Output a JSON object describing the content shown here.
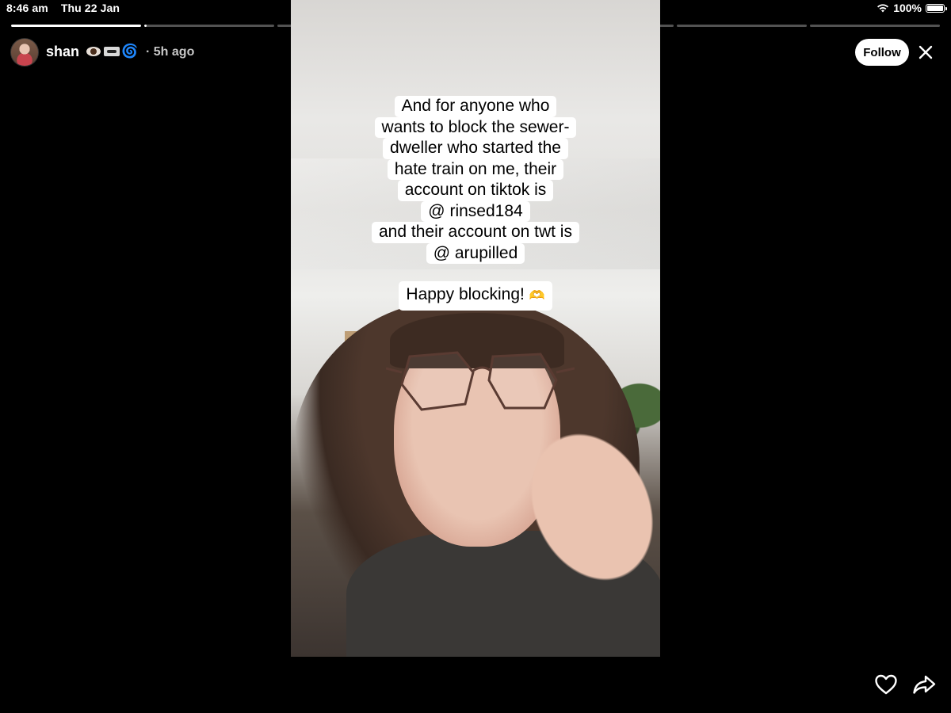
{
  "status_bar": {
    "time": "8:46 am",
    "date": "Thu 22 Jan",
    "battery": "100%",
    "wifi_icon": "wifi-icon",
    "battery_icon": "battery-full-icon"
  },
  "story_progress": {
    "segment_count": 7,
    "current_index": 1,
    "current_fraction": 0.02
  },
  "header": {
    "username": "shan",
    "emojis": [
      "eye-emoji",
      "cassette-emoji",
      "spiral-emoji"
    ],
    "time_ago": "· 5h ago",
    "follow_label": "Follow",
    "close_icon": "close-icon"
  },
  "caption": {
    "lines": [
      "And for anyone who",
      "wants to block the sewer-",
      "dweller who started the",
      "hate train on me, their",
      "account on tiktok is",
      "@ rinsed184",
      "and their account on twt is",
      "@ arupilled"
    ],
    "closing": "Happy blocking!",
    "closing_emoji": "🫶"
  },
  "footer": {
    "like_icon": "heart-icon",
    "share_icon": "share-arrow-icon"
  }
}
